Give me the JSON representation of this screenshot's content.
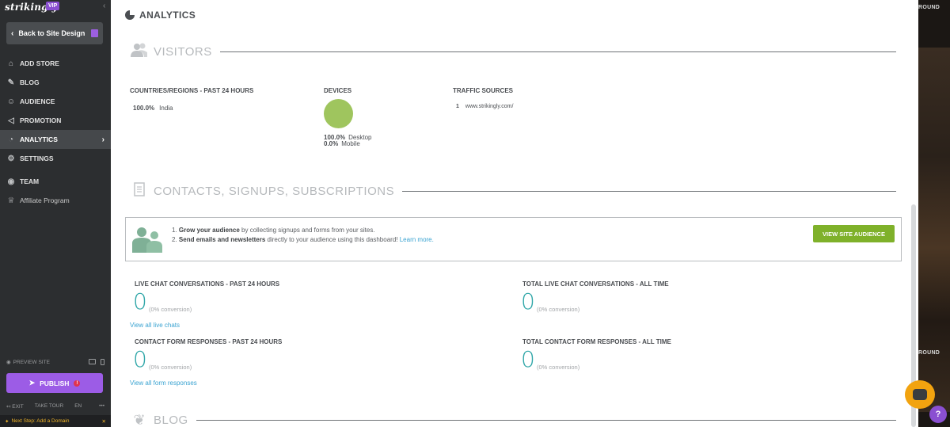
{
  "sidebar": {
    "brand": "strikingly",
    "vip_badge": "VIP",
    "back_label": "Back to Site Design",
    "items": [
      {
        "label": "ADD STORE",
        "icon": "storefront-icon"
      },
      {
        "label": "BLOG",
        "icon": "quill-icon"
      },
      {
        "label": "AUDIENCE",
        "icon": "people-icon"
      },
      {
        "label": "PROMOTION",
        "icon": "megaphone-icon"
      },
      {
        "label": "ANALYTICS",
        "icon": "pie-chart-icon"
      },
      {
        "label": "SETTINGS",
        "icon": "gear-icon"
      },
      {
        "label": "TEAM",
        "icon": "team-icon"
      },
      {
        "label": "Affiliate Program",
        "icon": "trophy-icon"
      }
    ],
    "preview_site": "PREVIEW SITE",
    "publish": "PUBLISH",
    "exit": "EXIT",
    "take_tour": "TAKE TOUR",
    "language": "EN",
    "more": "•••",
    "next_step": "Next Step: Add a Domain",
    "next_step_close": "✕"
  },
  "main": {
    "title": "ANALYTICS",
    "visitors": {
      "heading": "VISITORS",
      "countries_label": "COUNTRIES/REGIONS - PAST 24 HOURS",
      "country_pct": "100.0%",
      "country_name": "India",
      "devices_label": "DEVICES",
      "desktop_pct": "100.0%",
      "desktop_label": "Desktop",
      "mobile_pct": "0.0%",
      "mobile_label": "Mobile",
      "traffic_label": "TRAFFIC SOURCES",
      "traffic_rank": "1",
      "traffic_source": "www.strikingly.com/"
    },
    "contacts": {
      "heading": "CONTACTS, SIGNUPS, SUBSCRIPTIONS",
      "line1_num": "1.",
      "line1_bold": "Grow your audience",
      "line1_rest": " by collecting signups and forms from your sites.",
      "line2_num": "2.",
      "line2_bold": "Send emails and newsletters",
      "line2_rest": " directly to your audience using this dashboard! ",
      "line2_link": "Learn more.",
      "audience_button": "VIEW SITE AUDIENCE"
    },
    "stats": {
      "live_chat_24h_label": "LIVE CHAT CONVERSATIONS - PAST 24 HOURS",
      "live_chat_24h_value": "0",
      "live_chat_24h_conv": "(0% conversion)",
      "live_chat_all_label": "TOTAL LIVE CHAT CONVERSATIONS - ALL TIME",
      "live_chat_all_value": "0",
      "live_chat_all_conv": "(0% conversion)",
      "view_chats_link": "View all live chats",
      "form_24h_label": "CONTACT FORM RESPONSES - PAST 24 HOURS",
      "form_24h_value": "0",
      "form_24h_conv": "(0% conversion)",
      "form_all_label": "TOTAL CONTACT FORM RESPONSES - ALL TIME",
      "form_all_value": "0",
      "form_all_conv": "(0% conversion)",
      "view_forms_link": "View all form responses"
    },
    "blog": {
      "heading": "BLOG"
    }
  },
  "right_strip": {
    "label_top": "ROUND",
    "label_mid": "ROUND"
  },
  "help": "?",
  "colors": {
    "sidebar_bg": "#2c2e30",
    "accent_purple": "#9c5ce6",
    "stat_teal": "#2fa6a8",
    "button_green": "#7fb12a",
    "device_green": "#9fc55e",
    "link_blue": "#3aa3d1",
    "chat_orange": "#f2a30f"
  }
}
